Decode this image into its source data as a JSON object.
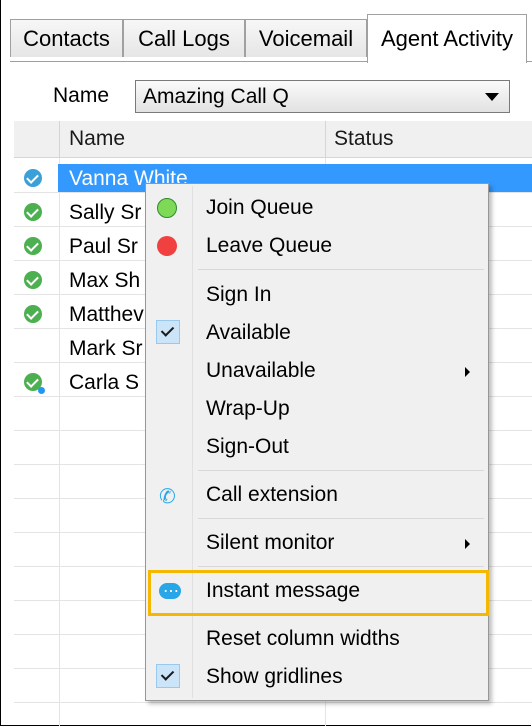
{
  "tabs": [
    {
      "label": "Contacts"
    },
    {
      "label": "Call Logs"
    },
    {
      "label": "Voicemail"
    },
    {
      "label": "Agent Activity",
      "active": true
    }
  ],
  "filter": {
    "label": "Name",
    "selected": "Amazing Call Q"
  },
  "grid": {
    "columns": [
      "Name",
      "Status"
    ],
    "rows": [
      {
        "name": "Vanna White",
        "status_icon": "check-circle-icon",
        "selected": true
      },
      {
        "name": "Sally Sr",
        "status_icon": "check-circle-icon"
      },
      {
        "name": "Paul Sr",
        "status_icon": "check-circle-icon"
      },
      {
        "name": "Max Sh",
        "status_icon": "check-circle-icon"
      },
      {
        "name": "Matthev",
        "status_icon": "check-circle-icon"
      },
      {
        "name": "Mark Sr",
        "status_icon": ""
      },
      {
        "name": "Carla S",
        "status_icon": "check-circle-dot-icon"
      }
    ]
  },
  "menu": {
    "join_queue": "Join Queue",
    "leave_queue": "Leave Queue",
    "sign_in": "Sign In",
    "available": "Available",
    "unavailable": "Unavailable",
    "wrap_up": "Wrap-Up",
    "sign_out": "Sign-Out",
    "call_extension": "Call extension",
    "silent_monitor": "Silent monitor",
    "instant_message": "Instant message",
    "reset_column_widths": "Reset column widths",
    "show_gridlines": "Show gridlines"
  },
  "colors": {
    "selection": "#3399ff",
    "highlight_border": "#f5b800",
    "status_green": "#4caf50",
    "icon_blue": "#28a6e8"
  }
}
